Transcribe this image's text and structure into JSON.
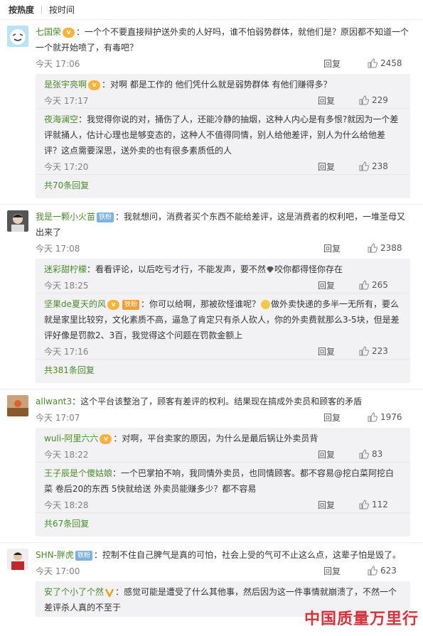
{
  "sort": {
    "hot": "按热度",
    "time": "按时间"
  },
  "threads": [
    {
      "user": "七国荣",
      "fan_badge": "",
      "text": "：一个个不要直接辩护送外卖的人好吗，谁不怕弱势群体，就他们是？原因都不知道一个一个就开始喷了，有毒吧？",
      "time": "今天 17:06",
      "reply": "回复",
      "likes": "2458",
      "subs": [
        {
          "user": "是张宇亮啊",
          "text": "：对啊 都是工作的 他们凭什么就是弱势群体 有他们赚得多？",
          "time": "今天 17:17",
          "reply": "回复",
          "likes": "229"
        },
        {
          "user": "夜海澜空",
          "text": "：我觉得你说的对，捅伤了人，还能冷静的抽烟，这种人内心是有多恨?就因为一个差评就捅人，估计心理也是够变态的，这种人不值得同情，别人给他差评，别人为什么给他差评？这点需要深思，送外卖的也有很多素质低的人",
          "time": "今天 17:20",
          "reply": "回复",
          "likes": "238"
        }
      ],
      "more": "共70条回复"
    },
    {
      "user": "我是一颗小火苗",
      "fan_badge": "铁粉",
      "text": "：我就想问，消费者买个东西不能给差评，这是消费者的权利吧，一堆圣母又出来了",
      "time": "今天 17:08",
      "reply": "回复",
      "likes": "2388",
      "subs": [
        {
          "user": "迷彩甜柠檬",
          "text_a": "：看看评论，以后吃亏才行，不能发声，要不然",
          "text_b": "咬你都得怪你存在",
          "time": "今天 18:25",
          "reply": "回复",
          "likes": "265"
        },
        {
          "user": "坚果de夏天的风",
          "fan_badge": "铁粉",
          "text_a": "：你可以给啊，那被砍怪谁呢？",
          "text_b": "做外卖快递的多半一无所有，要么就是家里比较穷，文化素质不高，逼急了肯定只有杀人砍人，你的外卖费就那么3-5块，但是差评好像是罚款2、3百，我觉得这个问题在罚款金额上",
          "time": "今天 17:16",
          "reply": "回复",
          "likes": "223"
        }
      ],
      "more": "共381条回复"
    },
    {
      "user": "allwant3",
      "fan_badge": "",
      "text": "：这个平台该整治了，顾客有差评的权利。结果现在搞成外卖员和顾客的矛盾",
      "time": "今天 17:07",
      "reply": "回复",
      "likes": "1976",
      "subs": [
        {
          "user": "wuli-阿里六六",
          "text": "：对啊，平台卖家的原因，为什么是最后锅让外卖员背",
          "time": "今天 18:22",
          "reply": "回复",
          "likes": "83"
        },
        {
          "user": "王子辰是个傻姑娘",
          "text": "：一个巴掌拍不响，我同情外卖员，也同情顾客。都不容易@挖白菜阿挖白菜 卷后20的东西 5快就给送 外卖员能赚多少？都不容易",
          "time": "今天 18:28",
          "reply": "回复",
          "likes": "112"
        }
      ],
      "more": "共67条回复"
    },
    {
      "user": "SHN-胖虎",
      "fan_badge": "铁粉",
      "text": "：控制不住自己脾气是真的可怕，社会上受的气可不止这么点，这辈子怕是毁了。",
      "time": "今天 17:00",
      "reply": "回复",
      "likes": "623",
      "subs": [
        {
          "user": "安了个小了个然",
          "text": "：感觉可能是遭受了什么其他事，然后因为这一件事情就崩溃了，不然一个差评杀人真的不至于"
        }
      ]
    }
  ],
  "watermark": "中国质量万里行",
  "colors": {
    "name": "#4a8a2a",
    "vip": "#f7b436",
    "fan": "#7cb2df",
    "subbg": "#f2f2f5"
  }
}
